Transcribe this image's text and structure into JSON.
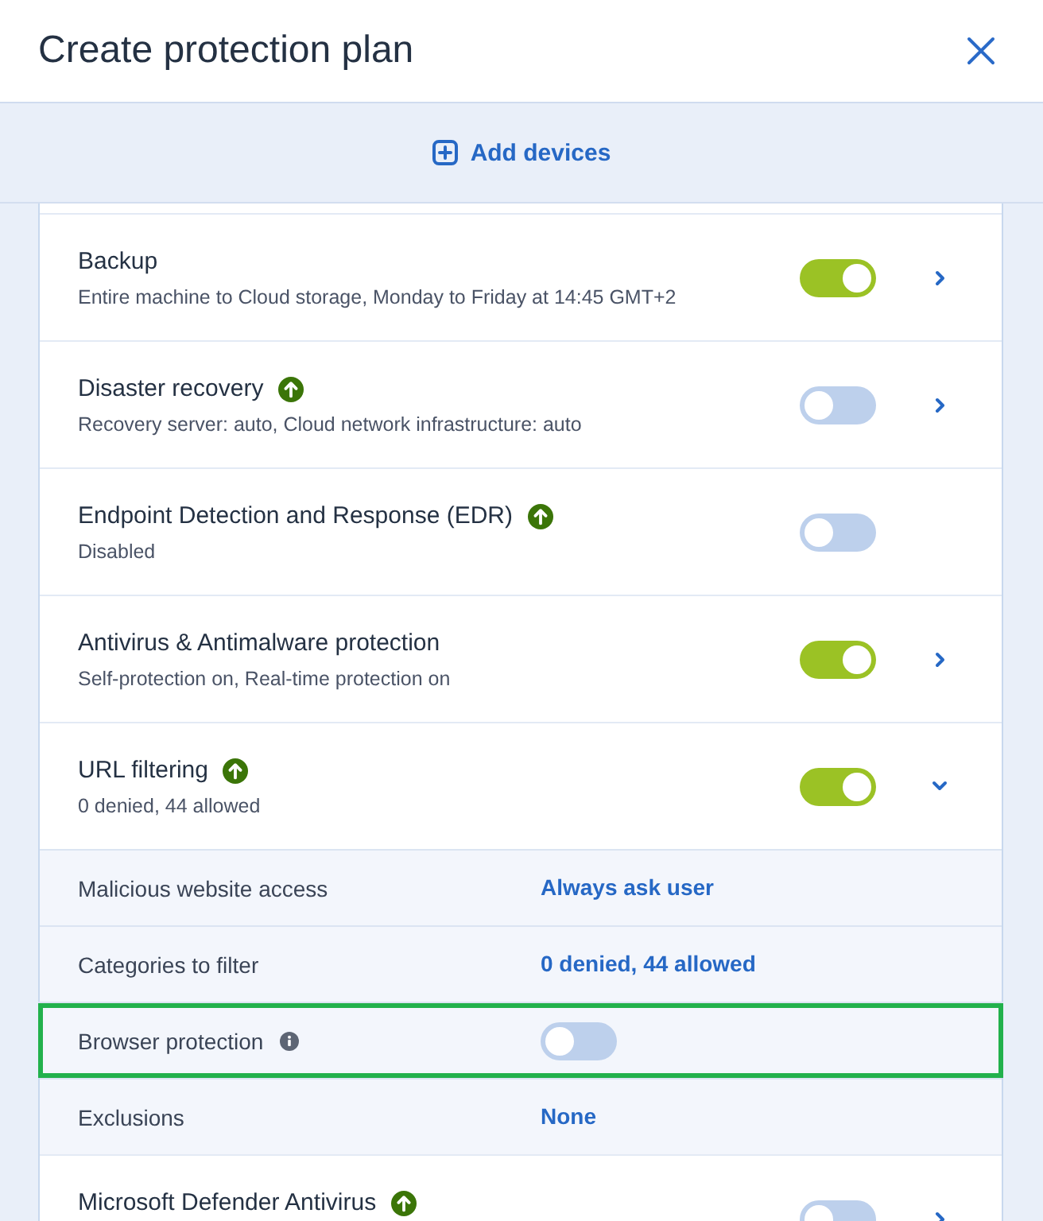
{
  "dialog": {
    "title": "Create protection plan"
  },
  "add_devices": {
    "label": "Add devices"
  },
  "modules": [
    {
      "title": "Backup",
      "subtitle": "Entire machine to Cloud storage, Monday to Friday at 14:45 GMT+2",
      "upgrade": false,
      "on": true,
      "expanded": false
    },
    {
      "title": "Disaster recovery",
      "subtitle": "Recovery server: auto, Cloud network infrastructure: auto",
      "upgrade": true,
      "on": false,
      "expanded": false
    },
    {
      "title": "Endpoint Detection and Response (EDR)",
      "subtitle": "Disabled",
      "upgrade": true,
      "on": false
    },
    {
      "title": "Antivirus & Antimalware protection",
      "subtitle": "Self-protection on, Real-time protection on",
      "upgrade": false,
      "on": true,
      "expanded": false
    },
    {
      "title": "URL filtering",
      "subtitle": "0 denied, 44 allowed",
      "upgrade": true,
      "on": true,
      "expanded": true,
      "settings": [
        {
          "kind": "link",
          "label": "Malicious website access",
          "value": "Always ask user",
          "info": false,
          "highlighted": false
        },
        {
          "kind": "link",
          "label": "Categories to filter",
          "value": "0 denied, 44 allowed",
          "info": false,
          "highlighted": false
        },
        {
          "kind": "toggle",
          "label": "Browser protection",
          "info": true,
          "on": false,
          "highlighted": true
        },
        {
          "kind": "link",
          "label": "Exclusions",
          "value": "None",
          "info": false,
          "highlighted": false
        }
      ]
    },
    {
      "title": "Microsoft Defender Antivirus",
      "upgrade": true,
      "on": false,
      "expanded": false
    }
  ]
}
